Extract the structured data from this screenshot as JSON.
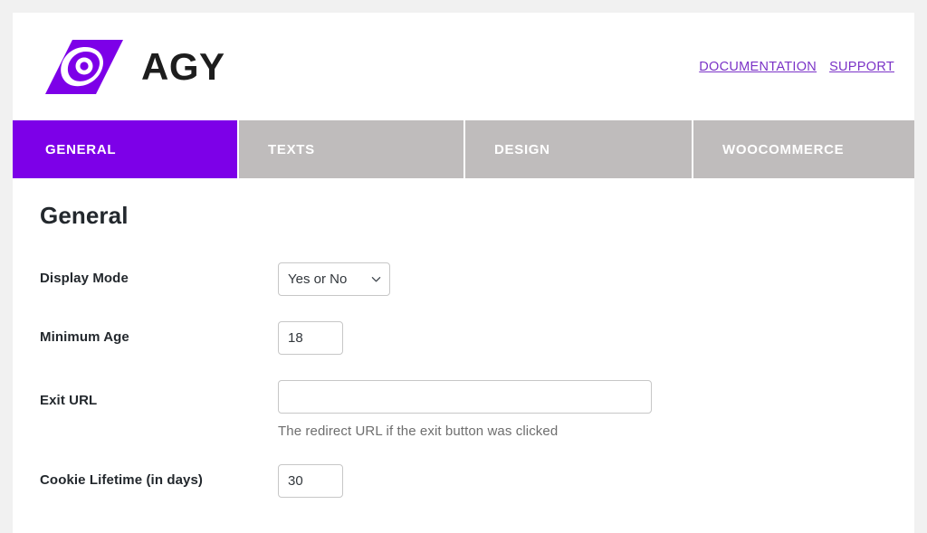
{
  "brand": {
    "logo_icon": "agy-monogram-logo",
    "name": "AGY",
    "accent_color": "#7d00e8"
  },
  "header": {
    "links": [
      {
        "label": "DOCUMENTATION",
        "name": "documentation-link"
      },
      {
        "label": "SUPPORT",
        "name": "support-link"
      }
    ],
    "link_color": "#7b33c7"
  },
  "tabs": {
    "active_index": 0,
    "active_color": "#7d00e8",
    "inactive_color": "#bfbcbc",
    "items": [
      {
        "label": "GENERAL"
      },
      {
        "label": "TEXTS"
      },
      {
        "label": "DESIGN"
      },
      {
        "label": "WOOCOMMERCE"
      }
    ]
  },
  "main": {
    "title": "General",
    "fields": {
      "display_mode": {
        "label": "Display Mode",
        "value": "Yes or No",
        "icon": "chevron-down-icon"
      },
      "minimum_age": {
        "label": "Minimum Age",
        "value": "18",
        "placeholder": ""
      },
      "exit_url": {
        "label": "Exit URL",
        "value": "",
        "placeholder": "",
        "help": "The redirect URL if the exit button was clicked"
      },
      "cookie_lifetime": {
        "label": "Cookie Lifetime (in days)",
        "value": "30",
        "placeholder": ""
      }
    }
  }
}
